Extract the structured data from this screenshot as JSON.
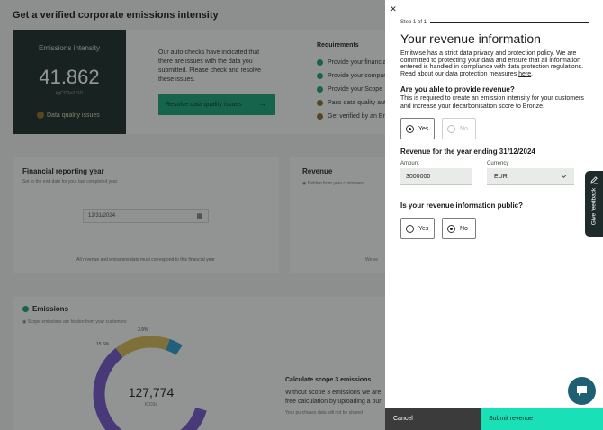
{
  "background": {
    "page_title": "Get a verified corporate emissions intensity",
    "kpi": {
      "label": "Emissions intensity",
      "value": "41.862",
      "unit": "kgCO2e/USD",
      "warning": "Data quality issues"
    },
    "warning_text": "Our auto-checks have indicated that there are issues with the data you submitted. Please check and resolve these issues.",
    "resolve_button": "Resolve data quality issues",
    "requirements": {
      "title": "Requirements",
      "items": [
        {
          "label": "Provide your financial",
          "color": "#1aa27a"
        },
        {
          "label": "Provide your company",
          "color": "#1aa27a"
        },
        {
          "label": "Provide your Scope",
          "color": "#1aa27a"
        },
        {
          "label": "Pass data quality aut",
          "color": "#8a6d22"
        },
        {
          "label": "Get verified by an Em",
          "color": "#8a6d22"
        }
      ]
    },
    "financial_year": {
      "title": "Financial reporting year",
      "subtitle": "Set to the end date for your last completed year",
      "date_value": "12/31/2024",
      "note": "All revenue and emissions data must correspond to this financial year"
    },
    "revenue_card": {
      "title": "Revenue",
      "subtitle": "Hidden from your customers",
      "note_fragment": "We ve"
    },
    "emissions": {
      "title": "Emissions",
      "subtitle": "Scope emissions are hidden from your customers",
      "total": "127,774",
      "unit": "tCO2e",
      "percent_labels": [
        "3.9%",
        "15.6%"
      ],
      "ring_colors": [
        "#7654c8",
        "#d8b657",
        "#2b9bd1"
      ]
    },
    "scope3": {
      "title": "Calculate scope 3 emissions",
      "text": "Without scope 3 emissions we are free calculation by uploading a pur",
      "sub": "Your purchases data will not be shared"
    }
  },
  "panel": {
    "close_icon": "close-icon",
    "step_label": "Step 1 of 1",
    "progress": 1.0,
    "title": "Your revenue information",
    "intro": "Emitwise has a strict data privacy and protection policy. We are committed to protecting your data and ensure that all information entered is handled in compliance with data protection regulations. Read about our data protection measures",
    "intro_link": "here",
    "q_provide": {
      "title": "Are you able to provide revenue?",
      "help": "This is required to create an emission intensity for your customers and increase your decarbonisation score to Bronze.",
      "options": [
        "Yes",
        "No"
      ],
      "selected": "Yes"
    },
    "revenue_section": {
      "title": "Revenue for the year ending 31/12/2024",
      "amount_label": "Amount",
      "amount_value": "3000000",
      "currency_label": "Currency",
      "currency_value": "EUR"
    },
    "q_public": {
      "title": "Is your revenue information public?",
      "options": [
        "Yes",
        "No"
      ],
      "selected": "No"
    },
    "cancel": "Cancel",
    "submit": "Submit revenue"
  },
  "feedback": {
    "label": "Give feedback",
    "icon": "pencil-icon"
  },
  "chat": {
    "icon": "chat-icon",
    "color": "#1e5f73"
  }
}
